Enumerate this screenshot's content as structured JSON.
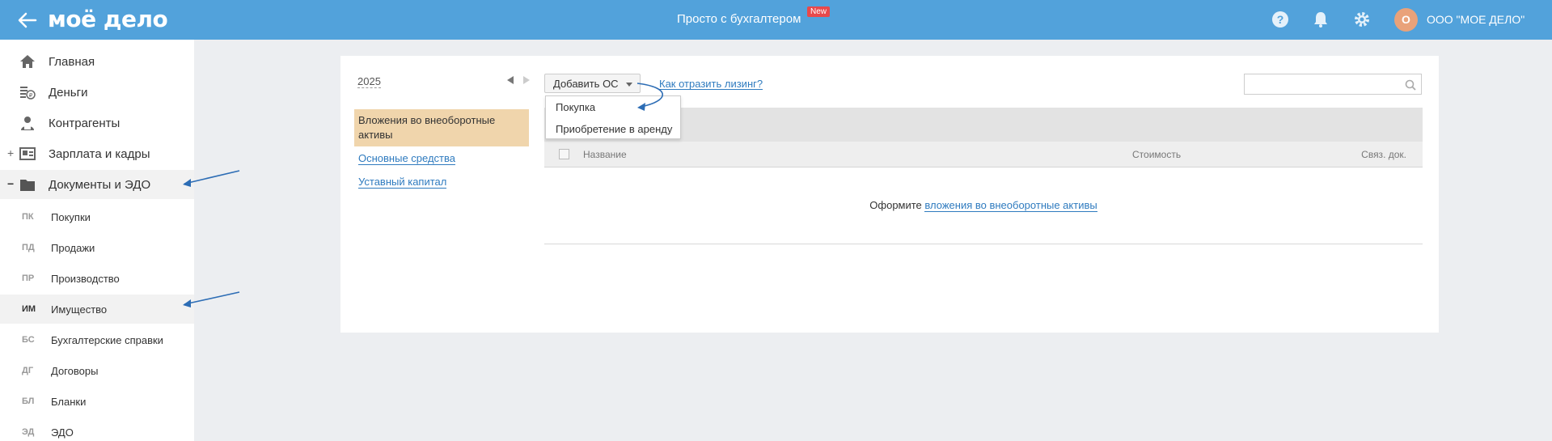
{
  "header": {
    "logo": "моё дело",
    "promo": "Просто с бухгалтером",
    "new_badge": "New",
    "avatar_letter": "О",
    "org_name": "ООО \"МОЕ ДЕЛО\"",
    "icons": [
      "back-arrow-icon",
      "help-icon",
      "bell-icon",
      "gear-icon"
    ]
  },
  "sidebar": {
    "items": [
      {
        "label": "Главная",
        "icon": "home-icon"
      },
      {
        "label": "Деньги",
        "icon": "money-icon"
      },
      {
        "label": "Контрагенты",
        "icon": "contractors-icon"
      },
      {
        "label": "Зарплата и кадры",
        "icon": "salary-icon",
        "expander": "+"
      },
      {
        "label": "Документы и ЭДО",
        "icon": "folder-icon",
        "expander": "−"
      }
    ],
    "sub_items": [
      {
        "abbr": "ПК",
        "label": "Покупки"
      },
      {
        "abbr": "ПД",
        "label": "Продажи"
      },
      {
        "abbr": "ПР",
        "label": "Производство"
      },
      {
        "abbr": "ИМ",
        "label": "Имущество"
      },
      {
        "abbr": "БС",
        "label": "Бухгалтерские справки"
      },
      {
        "abbr": "ДГ",
        "label": "Договоры"
      },
      {
        "abbr": "БЛ",
        "label": "Бланки"
      },
      {
        "abbr": "ЭД",
        "label": "ЭДО"
      }
    ]
  },
  "content": {
    "year": "2025",
    "categories": [
      {
        "label": "Вложения во внеоборотные активы"
      },
      {
        "label": "Основные средства"
      },
      {
        "label": "Уставный капитал"
      }
    ],
    "add_button": "Добавить ОС",
    "leasing_link": "Как отразить лизинг?",
    "search_placeholder": "",
    "dropdown": [
      "Покупка",
      "Приобретение в аренду"
    ],
    "table_headers": [
      "Название",
      "Стоимость",
      "Связ. док."
    ],
    "empty_prefix": "Оформите",
    "empty_link": "вложения во внеоборотные активы"
  },
  "colors": {
    "header_bg": "#52a2db",
    "accent_link": "#2f7bbf",
    "active_category": "#f0d5ac",
    "new_badge": "#e8494b",
    "avatar": "#e9a27a"
  }
}
